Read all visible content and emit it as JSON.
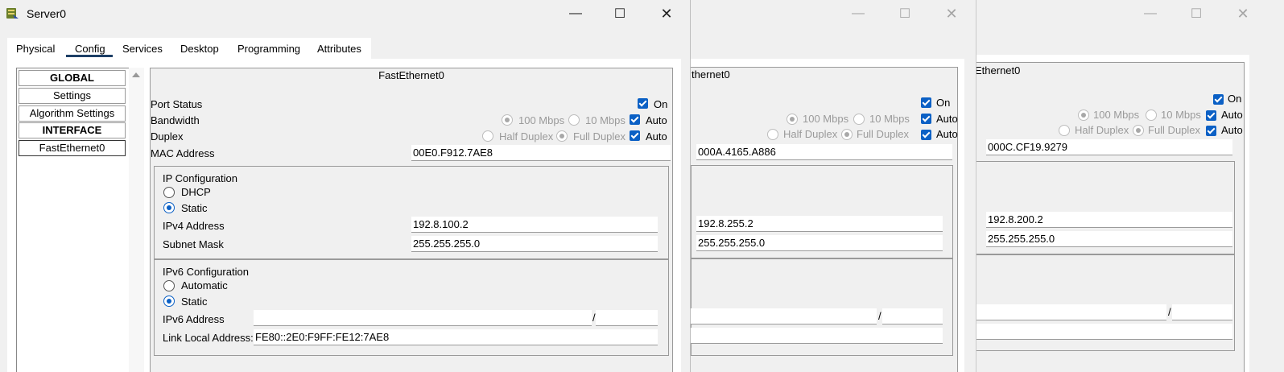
{
  "win3": {
    "panel_title": "Ethernet0",
    "on_label": "On",
    "bw_100": "100 Mbps",
    "bw_10": "10 Mbps",
    "auto1": "Auto",
    "half": "Half Duplex",
    "full": "Full Duplex",
    "auto2": "Auto",
    "mac": "000C.CF19.9279",
    "ipv4": "192.8.200.2",
    "mask": "255.255.255.0",
    "slash": "/"
  },
  "win2": {
    "panel_title": "thernet0",
    "on_label": "On",
    "bw_100": "100 Mbps",
    "bw_10": "10 Mbps",
    "auto1": "Auto",
    "half": "Half Duplex",
    "full": "Full Duplex",
    "auto2": "Auto",
    "mac": "000A.4165.A886",
    "ipv4": "192.8.255.2",
    "mask": "255.255.255.0",
    "slash": "/"
  },
  "win1": {
    "title": "Server0",
    "tabs": [
      "Physical",
      "Config",
      "Services",
      "Desktop",
      "Programming",
      "Attributes"
    ],
    "sidebar": [
      "GLOBAL",
      "Settings",
      "Algorithm Settings",
      "INTERFACE",
      "FastEthernet0"
    ],
    "panel_title": "FastEthernet0",
    "port_status": "Port Status",
    "on_label": "On",
    "bandwidth": "Bandwidth",
    "bw_100": "100 Mbps",
    "bw_10": "10 Mbps",
    "auto1": "Auto",
    "duplex": "Duplex",
    "half": "Half Duplex",
    "full": "Full Duplex",
    "auto2": "Auto",
    "mac_label": "MAC Address",
    "mac": "00E0.F912.7AE8",
    "ipcfg": "IP Configuration",
    "dhcp": "DHCP",
    "static": "Static",
    "ipv4_label": "IPv4 Address",
    "ipv4": "192.8.100.2",
    "mask_label": "Subnet Mask",
    "mask": "255.255.255.0",
    "ipv6cfg": "IPv6 Configuration",
    "automatic": "Automatic",
    "static6": "Static",
    "ipv6_label": "IPv6 Address",
    "ipv6": "",
    "slash": "/",
    "prefix": "",
    "lla_label": "Link Local Address:",
    "lla": "FE80::2E0:F9FF:FE12:7AE8"
  }
}
